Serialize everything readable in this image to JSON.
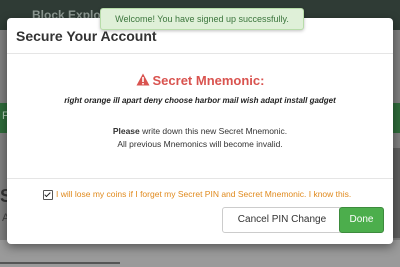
{
  "background": {
    "app_title": "Block Explo",
    "green_bar_letter": "F",
    "heading_letter": "S",
    "sub_letter": "A"
  },
  "toast": {
    "message": "Welcome! You have signed up successfully."
  },
  "modal": {
    "title": "Secure Your Account",
    "mnemonic_heading": "Secret Mnemonic:",
    "mnemonic_words": "right orange ill apart deny choose harbor mail wish adapt install gadget",
    "instruction_bold": "Please",
    "instruction_rest": " write down this new Secret Mnemonic.",
    "instruction_line2": "All previous Mnemonics will become invalid.",
    "confirm_checked": true,
    "confirm_label": "I will lose my coins if I forget my Secret PIN and Secret Mnemonic. I know this.",
    "cancel_label": "Cancel PIN Change",
    "done_label": "Done"
  },
  "colors": {
    "danger": "#d9534f",
    "warning_text": "#e08a1e",
    "success": "#4cae4c",
    "toast_bg": "#dff0d8"
  },
  "icons": {
    "mnemonic_heading_icon": "warning-triangle-icon"
  }
}
